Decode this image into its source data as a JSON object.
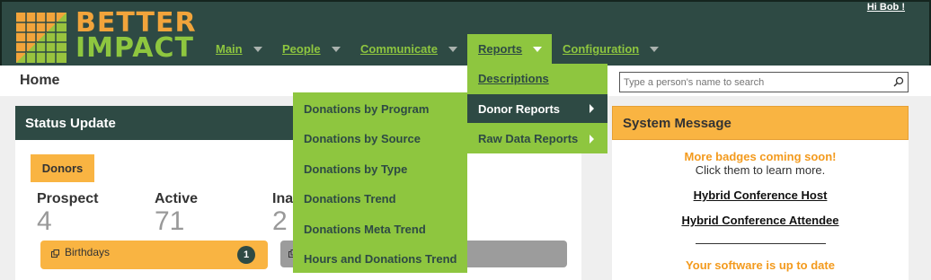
{
  "app": {
    "logo_line1": "BETTER",
    "logo_line2": "IMPACT",
    "greeting": "Hi Bob !"
  },
  "nav": [
    {
      "label": "Main"
    },
    {
      "label": "People"
    },
    {
      "label": "Communicate"
    },
    {
      "label": "Reports",
      "active": true
    },
    {
      "label": "Configuration"
    }
  ],
  "page": {
    "title": "Home"
  },
  "search": {
    "placeholder": "Type a person's name to search"
  },
  "status": {
    "title": "Status Update",
    "tab": "Donors",
    "stats": [
      {
        "label": "Prospect",
        "value": "4"
      },
      {
        "label": "Active",
        "value": "71"
      },
      {
        "label": "Ina",
        "value": "2"
      }
    ],
    "birthdays_label": "Birthdays",
    "birthdays_count": "1"
  },
  "system": {
    "title": "System Message",
    "badge_msg": "More badges coming soon!",
    "badge_sub": "Click them to learn more.",
    "links": [
      "Hybrid Conference Host",
      "Hybrid Conference Attendee"
    ],
    "uptodate": "Your software is up to date"
  },
  "reports_menu": [
    "Descriptions",
    "Donor Reports",
    "Raw Data Reports"
  ],
  "donor_submenu": [
    "Donations by Program",
    "Donations by Source",
    "Donations by Type",
    "Donations Trend",
    "Donations Meta Trend",
    "Hours and Donations Trend"
  ],
  "colors": {
    "header": "#2e4a44",
    "accent_green": "#8ec63f",
    "accent_orange": "#f9b442"
  }
}
